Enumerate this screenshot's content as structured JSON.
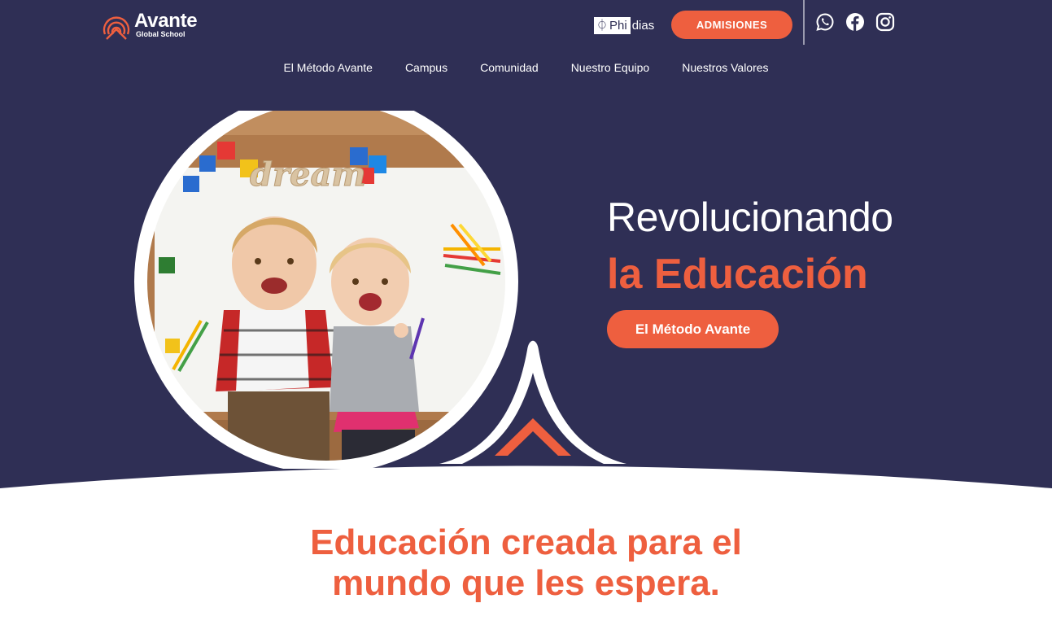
{
  "brand": {
    "name": "Avante",
    "subtitle": "Global School",
    "primary_color": "#2f2f55",
    "accent_color": "#ee5f3f"
  },
  "header": {
    "phidias": {
      "boxed": "Phi",
      "rest": "dias"
    },
    "admissions_label": "ADMISIONES",
    "social_icons": [
      "whatsapp-icon",
      "facebook-icon",
      "instagram-icon"
    ]
  },
  "nav": {
    "items": [
      "El Método Avante",
      "Campus",
      "Comunidad",
      "Nuestro Equipo",
      "Nuestros Valores"
    ]
  },
  "hero": {
    "headline_line1": "Revolucionando",
    "headline_line2": "la Educación",
    "cta_label": "El Método Avante",
    "image_sign_text": "dream"
  },
  "section": {
    "title_line1": "Educación creada para el",
    "title_line2": "mundo que les espera."
  }
}
